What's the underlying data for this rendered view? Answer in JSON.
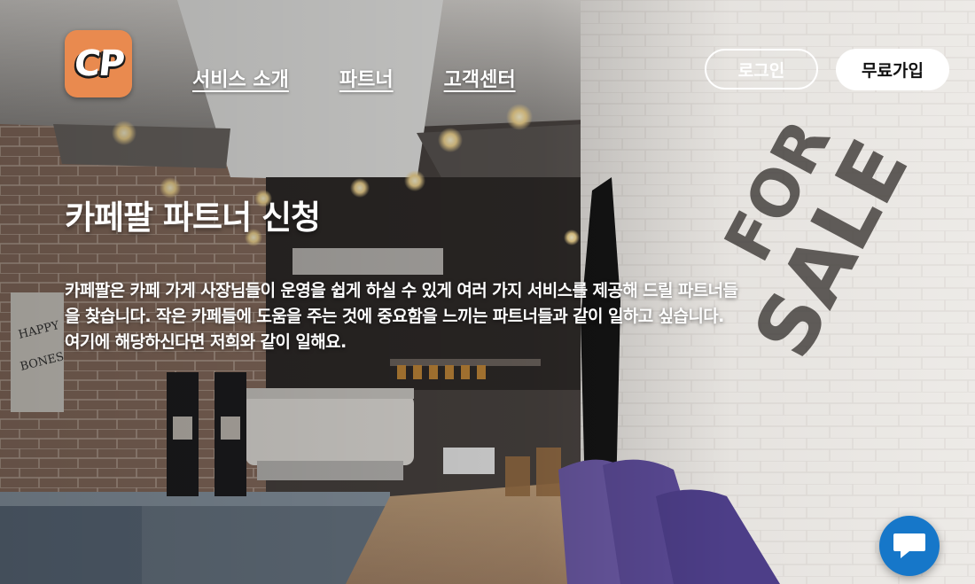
{
  "logo": {
    "text": "CP"
  },
  "nav": {
    "items": [
      {
        "label": "서비스 소개"
      },
      {
        "label": "파트너"
      },
      {
        "label": "고객센터"
      }
    ]
  },
  "auth": {
    "login_label": "로그인",
    "signup_label": "무료가입"
  },
  "hero": {
    "title": "카페팔 파트너 신청",
    "description": "카페팔은 카페 가게 사장님들이 운영을 쉽게 하실 수 있게 여러 가지 서비스를 제공해 드릴 파트너들을 찾습니다. 작은 카페들에 도움을 주는 것에 중요함을 느끼는 파트너들과 같이 일하고 싶습니다. 여기에 해당하신다면 저희와 같이 일해요."
  },
  "icons": {
    "chat": "chat-bubble-icon"
  },
  "colors": {
    "logo_bg": "#e98a4f",
    "chat_bg": "#1677c9",
    "signup_bg": "#ffffff",
    "text": "#ffffff"
  }
}
